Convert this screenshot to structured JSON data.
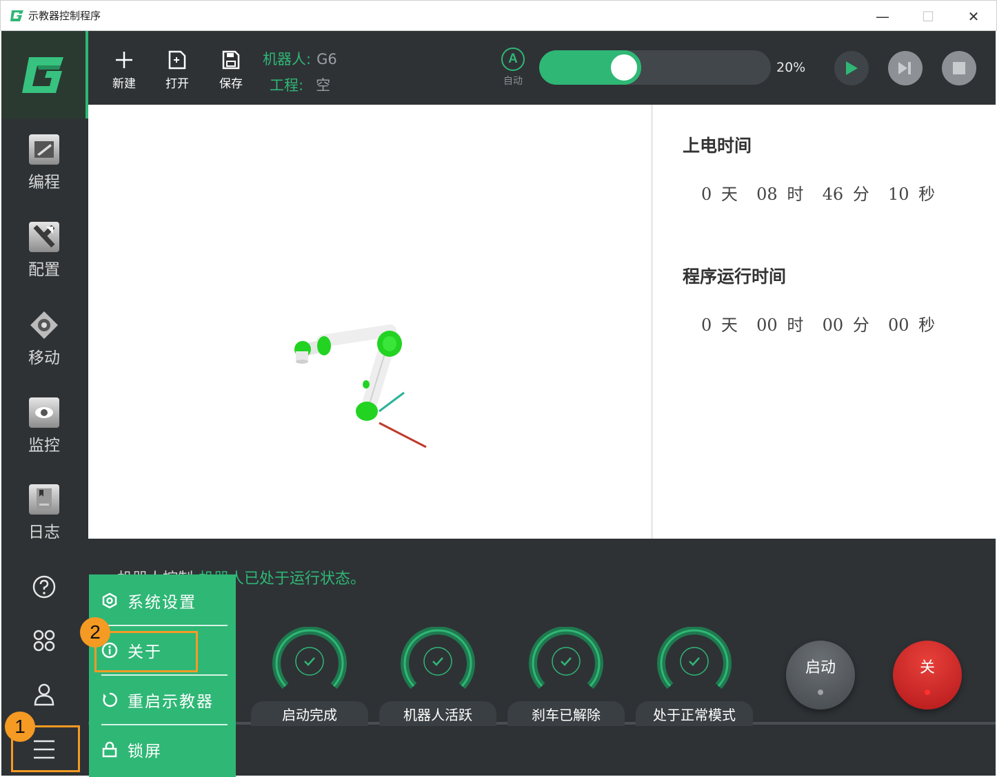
{
  "window": {
    "title": "示教器控制程序",
    "minimize": "—",
    "maximize": "☐",
    "close": "✕"
  },
  "sidebar": {
    "items": [
      {
        "label": "编程",
        "icon": "program-icon"
      },
      {
        "label": "配置",
        "icon": "config-icon"
      },
      {
        "label": "移动",
        "icon": "move-icon"
      },
      {
        "label": "监控",
        "icon": "monitor-icon"
      },
      {
        "label": "日志",
        "icon": "log-icon"
      }
    ],
    "help_icon": "help-icon",
    "apps_icon": "apps-icon",
    "user_icon": "user-icon",
    "menu_icon": "hamburger-menu-icon"
  },
  "toolbar": {
    "new_label": "新建",
    "open_label": "打开",
    "save_label": "保存",
    "robot_key": "机器人:",
    "robot_value": "G6",
    "project_key": "工程:",
    "project_value": "空",
    "mode_badge": "A",
    "mode_label": "自动",
    "speed_value": "20%",
    "speed_fraction": 0.2
  },
  "info": {
    "power_on_title": "上电时间",
    "power_on_time": "0 天  08 时  46 分  10 秒",
    "run_title": "程序运行时间",
    "run_time": "0 天  00 时  00 分  00 秒"
  },
  "status": {
    "prefix": "机器人控制",
    "message": "机器人已处于运行状态。"
  },
  "indicators": [
    "启动完成",
    "机器人活跃",
    "刹车已解除",
    "处于正常模式"
  ],
  "buttons": {
    "start_label": "启动",
    "off_label": "关"
  },
  "menu": {
    "items": [
      "系统设置",
      "关于",
      "重启示教器",
      "锁屏"
    ]
  },
  "annotations": {
    "badge_1": "1",
    "badge_2": "2"
  },
  "colors": {
    "accent": "#2fb776",
    "dark_bg": "#2e3235",
    "highlight": "#f59a23",
    "stop_red": "#d0201c"
  }
}
